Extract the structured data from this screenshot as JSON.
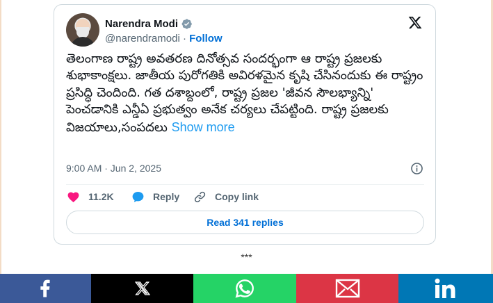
{
  "tweet": {
    "author_name": "Narendra Modi",
    "handle": "@narendramodi",
    "separator_dot": "·",
    "follow_label": "Follow",
    "text": "తెలంగాణ రాష్ట్ర అవతరణ దినోత్సవ సందర్భంగా ఆ రాష్ట్ర ప్రజలకు శుభాకాంక్షలు. జాతీయ పురోగతికి అవిరళమైన కృషి చేసినందుకు ఈ రాష్ట్రం ప్రసిద్ధి చెందింది. గత దశాబ్దంలో, రాష్ట్ర ప్రజల 'జీవన సౌలభ్యాన్ని' పెంచడానికి ఎన్డీఏ ప్రభుత్వం అనేక చర్యలు చేపట్టింది. రాష్ట్ర ప్రజలకు విజయాలు,సంపదలు",
    "show_more_label": "Show more",
    "timestamp": "9:00 AM · Jun 2, 2025",
    "like_count": "11.2K",
    "reply_label": "Reply",
    "copy_link_label": "Copy link",
    "read_replies_label": "Read 341 replies",
    "icons": [
      "avatar",
      "verified-badge-icon",
      "x-logo-icon",
      "info-icon",
      "heart-icon",
      "reply-icon",
      "link-icon"
    ]
  },
  "article": {
    "separator": "***"
  },
  "share_bar": {
    "buttons": [
      {
        "name": "facebook",
        "icon": "facebook-icon",
        "color": "#3b5998"
      },
      {
        "name": "x",
        "icon": "x-icon",
        "color": "#000000"
      },
      {
        "name": "whatsapp",
        "icon": "whatsapp-icon",
        "color": "#25d366"
      },
      {
        "name": "email",
        "icon": "envelope-icon",
        "color": "#dc3545"
      },
      {
        "name": "linkedin",
        "icon": "linkedin-icon",
        "color": "#0077b5"
      }
    ]
  },
  "colors": {
    "link_blue": "#1d9bf0",
    "follow_blue": "#006fd6",
    "like_red": "#f91880",
    "muted_gray": "#536471",
    "border": "#cfd9de"
  }
}
